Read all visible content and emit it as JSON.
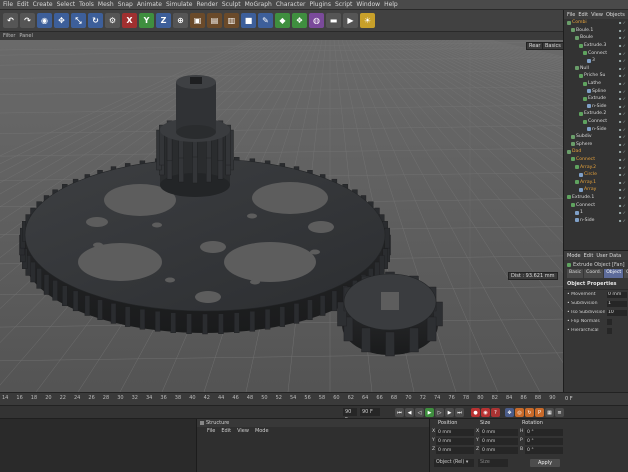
{
  "menu": [
    "File",
    "Edit",
    "Create",
    "Select",
    "Tools",
    "Mesh",
    "Snap",
    "Animate",
    "Simulate",
    "Render",
    "Sculpt",
    "MoGraph",
    "Character",
    "Plugins",
    "Script",
    "Window",
    "Help"
  ],
  "toolbar_icons": [
    "undo-icon",
    "redo-icon",
    "live-select-icon",
    "move-icon",
    "scale-icon",
    "rotate-icon",
    "recent-tools-icon",
    "x-axis-icon",
    "y-axis-icon",
    "z-axis-icon",
    "coordinate-system-icon",
    "render-view-icon",
    "render-picture-viewer-icon",
    "edit-render-settings-icon",
    "cube-icon",
    "pen-icon",
    "subdivision-icon",
    "array-icon",
    "deformer-icon",
    "floor-icon",
    "camera-icon",
    "light-icon"
  ],
  "toolbar_glyphs": [
    "↶",
    "↷",
    "◉",
    "✥",
    "⤡",
    "↻",
    "⚙",
    "X",
    "Y",
    "Z",
    "⊕",
    "▣",
    "▤",
    "▥",
    "■",
    "✎",
    "◆",
    "❖",
    "◍",
    "▬",
    "▶",
    "☀"
  ],
  "viewport": {
    "header": [
      "Filter",
      "Panel"
    ],
    "corner_label": "Rear",
    "corner_label2": "Basics",
    "measure_label": "Dist : 93.621 mm"
  },
  "object_manager": {
    "menu": [
      "File",
      "Edit",
      "View",
      "Objects"
    ],
    "rows": [
      {
        "indent": 0,
        "label": "Combi",
        "color": "#e6a23c",
        "icon": "#6a9e6a"
      },
      {
        "indent": 1,
        "label": "Boule.1",
        "color": "#d8d8d8",
        "icon": "#6a9e6a"
      },
      {
        "indent": 2,
        "label": "Boule",
        "color": "#d8d8d8",
        "icon": "#6a9e6a"
      },
      {
        "indent": 3,
        "label": "Extrude.3",
        "color": "#d8d8d8",
        "icon": "#5fa35f"
      },
      {
        "indent": 4,
        "label": "Connect",
        "color": "#d8d8d8",
        "icon": "#5fa35f"
      },
      {
        "indent": 5,
        "label": "3",
        "color": "#d8d8d8",
        "icon": "#7fa0c8"
      },
      {
        "indent": 2,
        "label": "Null",
        "color": "#d8d8d8",
        "icon": "#6a9e6a"
      },
      {
        "indent": 3,
        "label": "Priche Su",
        "color": "#d8d8d8",
        "icon": "#5fa35f"
      },
      {
        "indent": 4,
        "label": "Lathe",
        "color": "#d8d8d8",
        "icon": "#5fa35f"
      },
      {
        "indent": 5,
        "label": "Spline",
        "color": "#d8d8d8",
        "icon": "#7fa0c8"
      },
      {
        "indent": 4,
        "label": "Extrude",
        "color": "#d8d8d8",
        "icon": "#5fa35f"
      },
      {
        "indent": 5,
        "label": "n-Side",
        "color": "#d8d8d8",
        "icon": "#7fa0c8"
      },
      {
        "indent": 3,
        "label": "Extrude.2",
        "color": "#d8d8d8",
        "icon": "#5fa35f"
      },
      {
        "indent": 4,
        "label": "Connect",
        "color": "#d8d8d8",
        "icon": "#5fa35f"
      },
      {
        "indent": 5,
        "label": "n-Side",
        "color": "#d8d8d8",
        "icon": "#7fa0c8"
      },
      {
        "indent": 1,
        "label": "Subdiv",
        "color": "#d8d8d8",
        "icon": "#6a9e6a"
      },
      {
        "indent": 1,
        "label": "Sphere",
        "color": "#d8d8d8",
        "icon": "#6a9e6a"
      },
      {
        "indent": 0,
        "label": "Dad",
        "color": "#e6a23c",
        "icon": "#6a9e6a"
      },
      {
        "indent": 1,
        "label": "Connect",
        "color": "#e6a23c",
        "icon": "#5fa35f"
      },
      {
        "indent": 2,
        "label": "Array.2",
        "color": "#e6a23c",
        "icon": "#5fa35f"
      },
      {
        "indent": 3,
        "label": "Circle",
        "color": "#e6a23c",
        "icon": "#7fa0c8"
      },
      {
        "indent": 2,
        "label": "Array.1",
        "color": "#e6a23c",
        "icon": "#5fa35f"
      },
      {
        "indent": 3,
        "label": "Array",
        "color": "#e6a23c",
        "icon": "#7fa0c8"
      },
      {
        "indent": 0,
        "label": "Extrude.1",
        "color": "#d8d8d8",
        "icon": "#5fa35f"
      },
      {
        "indent": 1,
        "label": "Connect",
        "color": "#d8d8d8",
        "icon": "#5fa35f"
      },
      {
        "indent": 2,
        "label": "1",
        "color": "#d8d8d8",
        "icon": "#7fa0c8"
      },
      {
        "indent": 2,
        "label": "n-Side",
        "color": "#d8d8d8",
        "icon": "#7fa0c8"
      }
    ]
  },
  "attributes": {
    "menu": [
      "Mode",
      "Edit",
      "User Data"
    ],
    "object_title": "Extrude Object [Fan]",
    "tabs": [
      "Basic",
      "Coord.",
      "Object",
      "Caps"
    ],
    "active_tab": "Object",
    "section": "Object Properties",
    "props": [
      {
        "label": "Movement",
        "value": "0 mm"
      },
      {
        "label": "Subdivision",
        "value": "1"
      },
      {
        "label": "Iso Subdivision",
        "value": "10"
      },
      {
        "label": "Flip Normals",
        "value": ""
      },
      {
        "label": "Hierarchical",
        "value": ""
      }
    ]
  },
  "timeline": {
    "ticks": [
      "14",
      "16",
      "18",
      "20",
      "22",
      "24",
      "26",
      "28",
      "30",
      "32",
      "34",
      "36",
      "38",
      "40",
      "42",
      "44",
      "46",
      "48",
      "50",
      "52",
      "54",
      "56",
      "58",
      "60",
      "62",
      "64",
      "66",
      "68",
      "70",
      "72",
      "74",
      "76",
      "78",
      "80",
      "82",
      "84",
      "86",
      "88",
      "90"
    ],
    "end_label": "0 F"
  },
  "transport": {
    "start_field": "90 F",
    "end_field": "90 F"
  },
  "structure": {
    "title": "Structure",
    "menu": [
      "File",
      "Edit",
      "View",
      "Mode"
    ]
  },
  "coords": {
    "headers": [
      "Position",
      "Size",
      "Rotation"
    ],
    "rows": [
      {
        "axis": "X",
        "pos": "0 mm",
        "size": "0 mm",
        "rot_axis": "H",
        "rot": "0 °"
      },
      {
        "axis": "Y",
        "pos": "0 mm",
        "size": "0 mm",
        "rot_axis": "P",
        "rot": "0 °"
      },
      {
        "axis": "Z",
        "pos": "0 mm",
        "size": "0 mm",
        "rot_axis": "B",
        "rot": "0 °"
      }
    ],
    "dropdown": "Object (Rel)",
    "dropdown2": "Size",
    "apply": "Apply"
  }
}
